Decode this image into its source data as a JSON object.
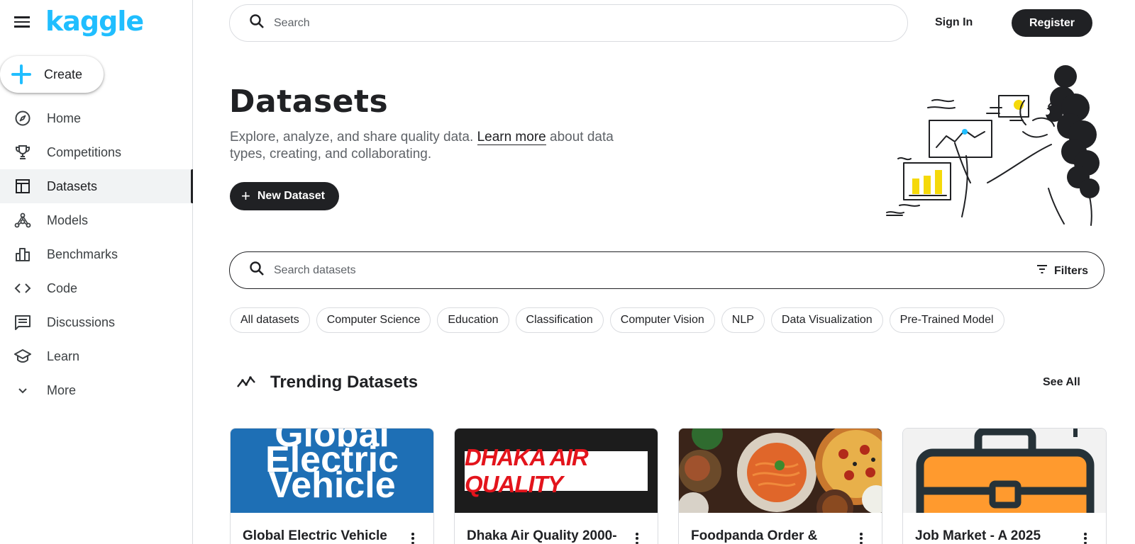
{
  "brand": {
    "logo_text": "kaggle",
    "color": "#20beff"
  },
  "sidebar": {
    "create_label": "Create",
    "items": [
      {
        "label": "Home",
        "icon": "compass-icon"
      },
      {
        "label": "Competitions",
        "icon": "trophy-icon"
      },
      {
        "label": "Datasets",
        "icon": "table-icon",
        "active": true
      },
      {
        "label": "Models",
        "icon": "models-icon"
      },
      {
        "label": "Benchmarks",
        "icon": "bar-chart-icon"
      },
      {
        "label": "Code",
        "icon": "code-icon"
      },
      {
        "label": "Discussions",
        "icon": "comments-icon"
      },
      {
        "label": "Learn",
        "icon": "school-icon"
      },
      {
        "label": "More",
        "icon": "chevron-down-icon"
      }
    ]
  },
  "header": {
    "search_placeholder": "Search",
    "sign_in_label": "Sign In",
    "register_label": "Register"
  },
  "hero": {
    "title": "Datasets",
    "desc_before": "Explore, analyze, and share quality data. ",
    "learn_more": "Learn more",
    "desc_after": " about data types, creating, and collaborating.",
    "new_dataset_label": "New Dataset"
  },
  "dataset_search": {
    "placeholder": "Search datasets",
    "filters_label": "Filters"
  },
  "chips": [
    "All datasets",
    "Computer Science",
    "Education",
    "Classification",
    "Computer Vision",
    "NLP",
    "Data Visualization",
    "Pre-Trained Model"
  ],
  "trending": {
    "title": "Trending Datasets",
    "see_all_label": "See All",
    "cards": [
      {
        "title": "Global Electric Vehicle",
        "image_text_1": "Global",
        "image_text_2": "Electric",
        "image_text_3": "Vehicle"
      },
      {
        "title": "Dhaka Air Quality 2000-",
        "image_text": "DHAKA AIR QUALITY"
      },
      {
        "title": "Foodpanda Order &"
      },
      {
        "title": "Job Market - A 2025"
      }
    ]
  }
}
